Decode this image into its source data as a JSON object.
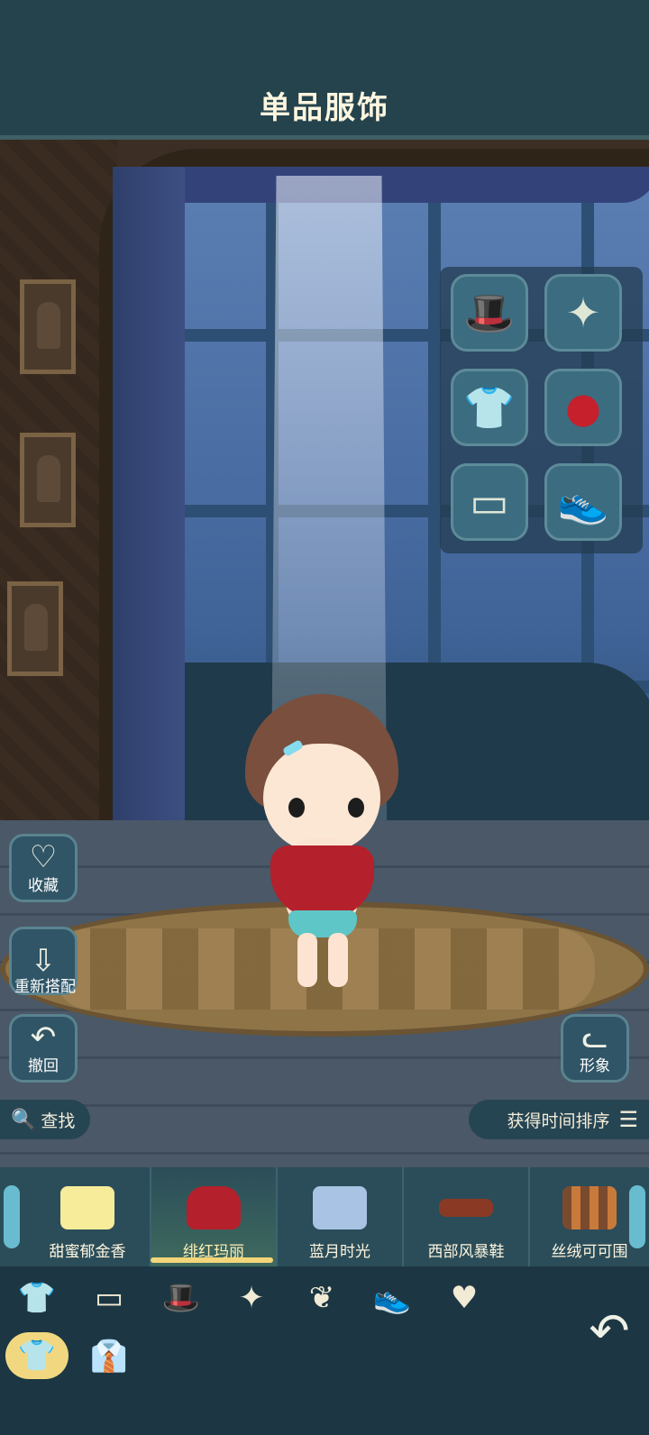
{
  "header": {
    "title": "单品服饰"
  },
  "category_buttons": [
    {
      "icon": "hat-icon"
    },
    {
      "icon": "necklace-icon"
    },
    {
      "icon": "shirt-icon"
    },
    {
      "icon": "red-bag-icon"
    },
    {
      "icon": "shorts-icon"
    },
    {
      "icon": "shoe-icon"
    }
  ],
  "side_buttons": {
    "favorite_label": "收藏",
    "rematch_label": "重新搭配",
    "undo_label": "撤回",
    "appearance_label": "形象"
  },
  "search": {
    "label": "查找"
  },
  "sort": {
    "label": "获得时间排序"
  },
  "items": [
    {
      "name": "甜蜜郁金香",
      "color": "#f7ec9a",
      "selected": false
    },
    {
      "name": "绯红玛丽",
      "color": "#b4202b",
      "selected": true
    },
    {
      "name": "蓝月时光",
      "color": "#a9c3e4",
      "selected": false
    },
    {
      "name": "西部风暴鞋",
      "color": "#8a3a24",
      "selected": false
    },
    {
      "name": "丝绒可可围",
      "color": "#7a4a2e",
      "selected": false
    }
  ],
  "tabs": [
    {
      "icon": "top-icon"
    },
    {
      "icon": "bottom-icon"
    },
    {
      "icon": "hat-icon"
    },
    {
      "icon": "necklace-icon"
    },
    {
      "icon": "accessory-icon"
    },
    {
      "icon": "shoe-icon"
    },
    {
      "icon": "heart-icon"
    }
  ],
  "colors": {
    "accent": "#f1d880",
    "panel": "#2b4d59",
    "background": "#22404a"
  }
}
